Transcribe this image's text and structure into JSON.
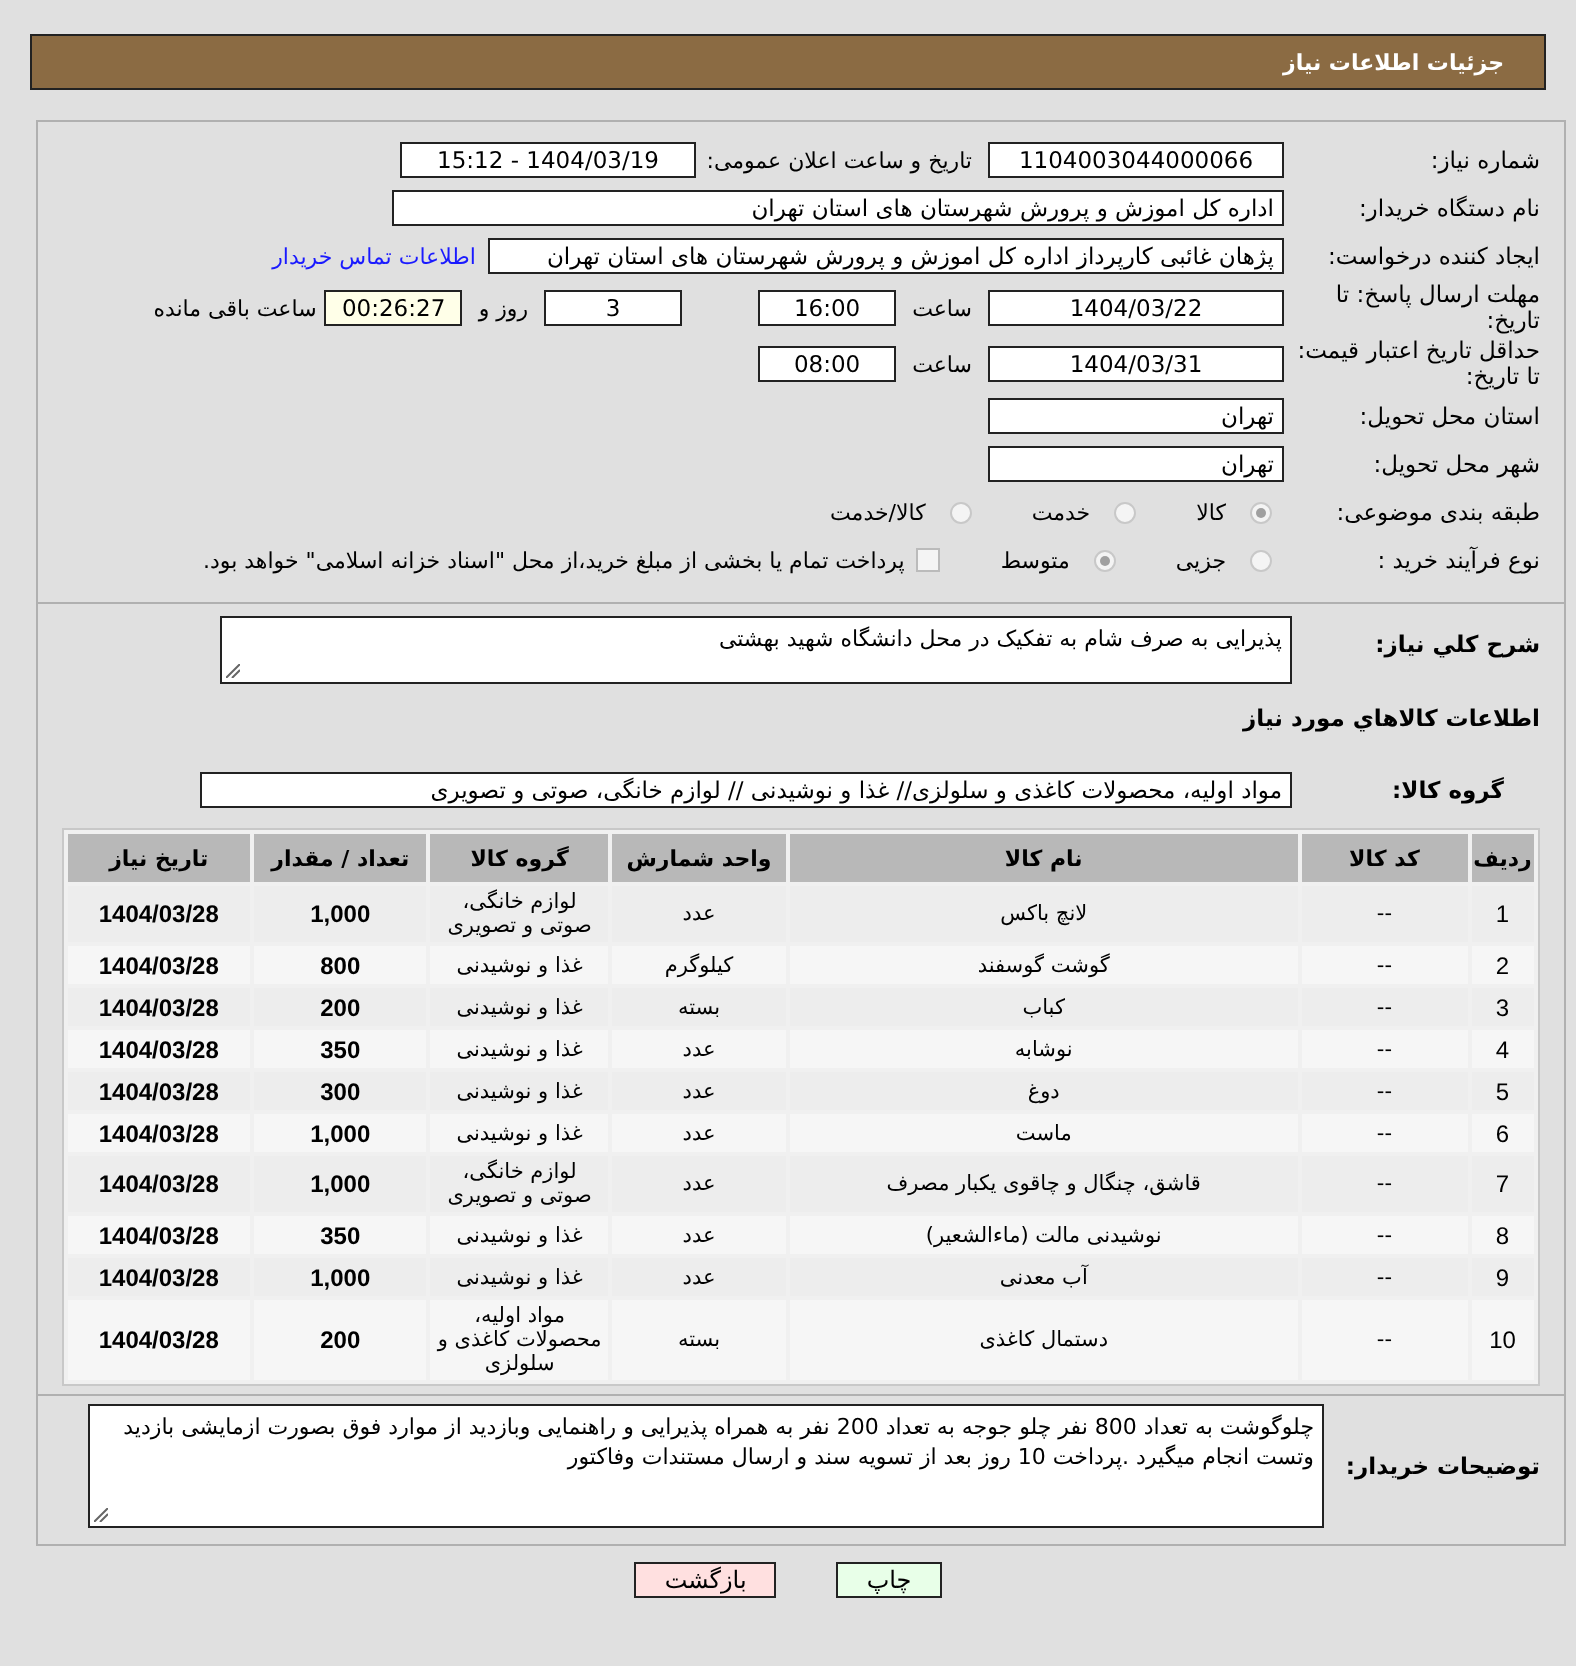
{
  "header": {
    "title": "جزئیات اطلاعات نیاز"
  },
  "need_number": {
    "label": "شماره نیاز:",
    "value": "1104003044000066"
  },
  "announce": {
    "label": "تاریخ و ساعت اعلان عمومی:",
    "value": "1404/03/19 - 15:12"
  },
  "buyer_org": {
    "label": "نام دستگاه خریدار:",
    "value": "اداره کل اموزش و پرورش شهرستان های استان تهران"
  },
  "requester": {
    "label": "ایجاد کننده درخواست:",
    "value": "پژهان غائبی کارپرداز اداره کل اموزش و پرورش شهرستان های استان تهران",
    "link": "اطلاعات تماس خریدار"
  },
  "deadline": {
    "label": "مهلت ارسال پاسخ: تا تاریخ:",
    "date": "1404/03/22",
    "time_label": "ساعت",
    "time": "16:00",
    "days": "3",
    "days_label": "روز و",
    "remaining": "00:26:27",
    "remaining_label": "ساعت باقی مانده"
  },
  "validity": {
    "label": "حداقل تاریخ اعتبار قیمت: تا تاریخ:",
    "date": "1404/03/31",
    "time_label": "ساعت",
    "time": "08:00"
  },
  "province": {
    "label": "استان محل تحویل:",
    "value": "تهران"
  },
  "city": {
    "label": "شهر محل تحویل:",
    "value": "تهران"
  },
  "category": {
    "label": "طبقه بندی موضوعی:",
    "options": [
      {
        "label": "کالا",
        "selected": true
      },
      {
        "label": "خدمت",
        "selected": false
      },
      {
        "label": "کالا/خدمت",
        "selected": false
      }
    ]
  },
  "process": {
    "label": "نوع فرآیند خرید :",
    "options": [
      {
        "label": "جزیی",
        "selected": false
      },
      {
        "label": "متوسط",
        "selected": true
      }
    ],
    "payment": {
      "label": "پرداخت تمام یا بخشی از مبلغ خرید،از محل \"اسناد خزانه اسلامی\" خواهد بود.",
      "checked": false
    }
  },
  "description": {
    "label": "شرح کلي نياز:",
    "value": "پذیرایی به صرف شام به تفکیک در محل  دانشگاه شهید بهشتی"
  },
  "goods_title": "اطلاعات کالاهاي مورد نياز",
  "goods_group": {
    "label": "گروه کالا:",
    "value": "مواد اولیه، محصولات کاغذی و سلولزی// غذا و نوشیدنی // لوازم خانگی، صوتی و تصویری"
  },
  "table": {
    "columns": [
      "ردیف",
      "کد کالا",
      "نام کالا",
      "واحد شمارش",
      "گروه کالا",
      "تعداد / مقدار",
      "تاریخ نیاز"
    ],
    "rows": [
      [
        "1",
        "--",
        "لانچ باکس",
        "عدد",
        "لوازم خانگی، صوتی و تصویری",
        "1,000",
        "1404/03/28"
      ],
      [
        "2",
        "--",
        "گوشت گوسفند",
        "کیلوگرم",
        "غذا و نوشیدنی",
        "800",
        "1404/03/28"
      ],
      [
        "3",
        "--",
        "کباب",
        "بسته",
        "غذا و نوشیدنی",
        "200",
        "1404/03/28"
      ],
      [
        "4",
        "--",
        "نوشابه",
        "عدد",
        "غذا و نوشیدنی",
        "350",
        "1404/03/28"
      ],
      [
        "5",
        "--",
        "دوغ",
        "عدد",
        "غذا و نوشیدنی",
        "300",
        "1404/03/28"
      ],
      [
        "6",
        "--",
        "ماست",
        "عدد",
        "غذا و نوشیدنی",
        "1,000",
        "1404/03/28"
      ],
      [
        "7",
        "--",
        "قاشق، چنگال و چاقوی یکبار مصرف",
        "عدد",
        "لوازم خانگی، صوتی و تصویری",
        "1,000",
        "1404/03/28"
      ],
      [
        "8",
        "--",
        "نوشیدنی مالت (ماءالشعیر)",
        "عدد",
        "غذا و نوشیدنی",
        "350",
        "1404/03/28"
      ],
      [
        "9",
        "--",
        "آب معدنی",
        "عدد",
        "غذا و نوشیدنی",
        "1,000",
        "1404/03/28"
      ],
      [
        "10",
        "--",
        "دستمال کاغذی",
        "بسته",
        "مواد اولیه، محصولات کاغذی و سلولزی",
        "200",
        "1404/03/28"
      ]
    ]
  },
  "buyer_notes": {
    "label": "توضیحات خریدار:",
    "value": "چلوگوشت به تعداد 800 نفر چلو جوجه به تعداد  200 نفر به همراه پذیرایی و راهنمایی وبازدید از موارد فوق بصورت ازمایشی بازدید وتست انجام میگیرد .پرداخت 10 روز بعد از تسویه سند و ارسال مستندات وفاکتور"
  },
  "buttons": [
    {
      "label": "چاپ",
      "kind": "print"
    },
    {
      "label": "بازگشت",
      "kind": "back"
    }
  ]
}
